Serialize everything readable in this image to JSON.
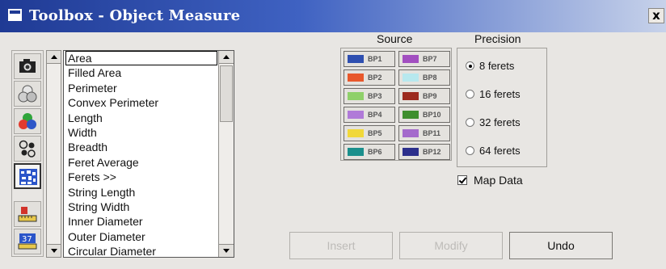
{
  "window": {
    "title": "Toolbox - Object Measure",
    "close_label": "x"
  },
  "toolbar": {
    "tools": [
      {
        "name": "camera-tool-icon"
      },
      {
        "name": "circles-tool-icon"
      },
      {
        "name": "rgb-circles-tool-icon"
      },
      {
        "name": "particles-tool-icon"
      },
      {
        "name": "pattern-tool-icon",
        "selected": true
      },
      {
        "name": "object-ruler-tool-icon"
      },
      {
        "name": "numeric-ruler-tool-icon"
      }
    ]
  },
  "measurements": {
    "selected": "Area",
    "items": [
      "Area",
      "Filled Area",
      "Perimeter",
      "Convex Perimeter",
      "Length",
      "Width",
      "Breadth",
      "Feret Average",
      "Ferets >>",
      "String Length",
      "String Width",
      "Inner Diameter",
      "Outer Diameter",
      "Circular Diameter"
    ]
  },
  "source": {
    "label": "Source",
    "bitplanes": [
      {
        "label": "BP1",
        "color": "#2f4fb0"
      },
      {
        "label": "BP2",
        "color": "#e8582c"
      },
      {
        "label": "BP3",
        "color": "#8fd06a"
      },
      {
        "label": "BP4",
        "color": "#b07ad8"
      },
      {
        "label": "BP5",
        "color": "#f1d839"
      },
      {
        "label": "BP6",
        "color": "#1b8f8c"
      },
      {
        "label": "BP7",
        "color": "#a24fc0"
      },
      {
        "label": "BP8",
        "color": "#b7e8ee"
      },
      {
        "label": "BP9",
        "color": "#9c2a1e"
      },
      {
        "label": "BP10",
        "color": "#3e8f2e"
      },
      {
        "label": "BP11",
        "color": "#a46acc"
      },
      {
        "label": "BP12",
        "color": "#2c2f8c"
      }
    ]
  },
  "precision": {
    "label": "Precision",
    "options": [
      "8 ferets",
      "16 ferets",
      "32 ferets",
      "64 ferets"
    ],
    "selected": "8 ferets"
  },
  "map_data": {
    "label": "Map Data",
    "checked": true
  },
  "buttons": {
    "insert": "Insert",
    "modify": "Modify",
    "undo": "Undo"
  }
}
